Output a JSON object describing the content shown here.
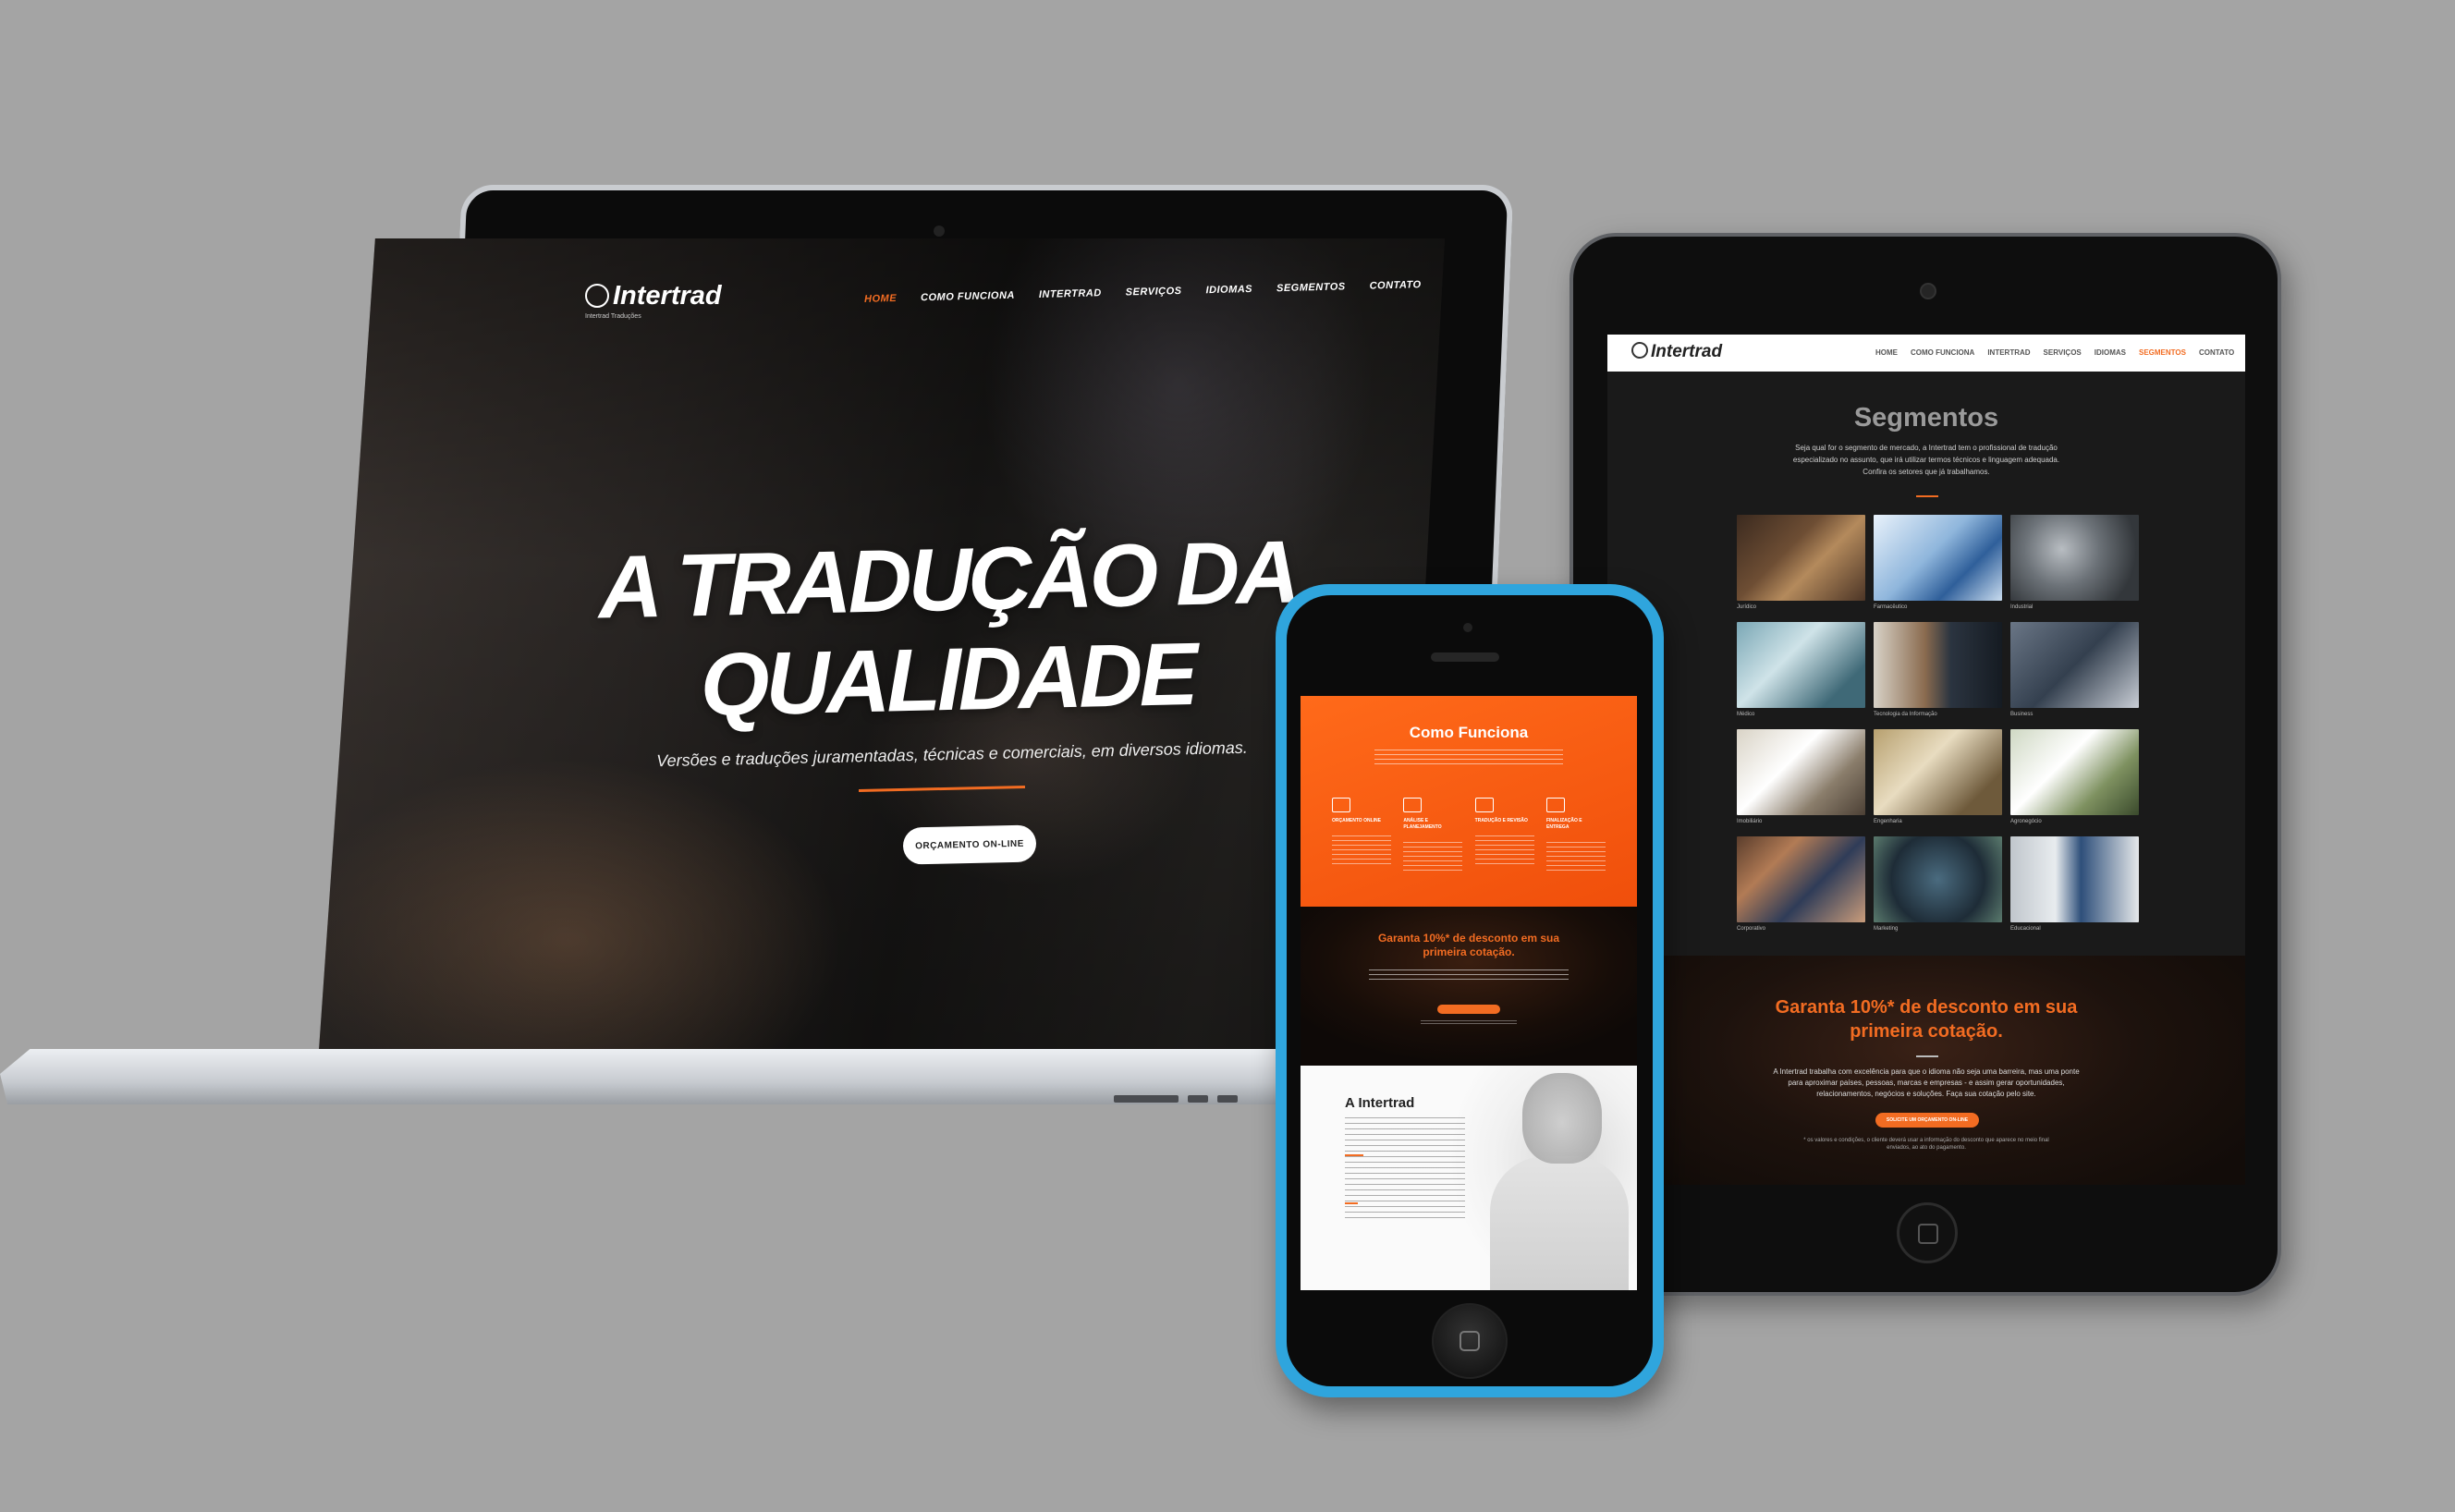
{
  "laptop": {
    "logo": {
      "name": "Intertrad",
      "tagline": "Intertrad Traduções"
    },
    "nav": [
      "HOME",
      "COMO FUNCIONA",
      "INTERTRAD",
      "SERVIÇOS",
      "IDIOMAS",
      "SEGMENTOS",
      "CONTATO"
    ],
    "hero_line1": "A TRADUÇÃO DA",
    "hero_line2": "QUALIDADE",
    "subtitle": "Versões e traduções juramentadas, técnicas e comerciais, em diversos idiomas.",
    "cta": "ORÇAMENTO ON-LINE"
  },
  "tablet": {
    "logo": "Intertrad",
    "nav": [
      "HOME",
      "COMO FUNCIONA",
      "INTERTRAD",
      "SERVIÇOS",
      "IDIOMAS",
      "SEGMENTOS",
      "CONTATO"
    ],
    "active_nav": "SEGMENTOS",
    "title": "Segmentos",
    "intro": "Seja qual for o segmento de mercado, a Intertrad tem o profissional de tradução especializado no assunto, que irá utilizar termos técnicos e linguagem adequada. Confira os setores que já trabalhamos.",
    "segments": [
      "Jurídico",
      "Farmacêutico",
      "Industrial",
      "Médico",
      "Tecnologia da Informação",
      "Business",
      "Imobiliário",
      "Engenharia",
      "Agronegócio",
      "Corporativo",
      "Marketing",
      "Educacional"
    ],
    "cta_line1": "Garanta 10%* de desconto em sua",
    "cta_line2": "primeira cotação.",
    "cta_text": "A Intertrad trabalha com excelência para que o idioma não seja uma barreira, mas uma ponte para aproximar países, pessoas, marcas e empresas - e assim gerar oportunidades, relacionamentos, negócios e soluções. Faça sua cotação pelo site.",
    "cta_button": "SOLICITE UM ORÇAMENTO ON-LINE",
    "cta_note": "* os valores e condições, o cliente deverá usar a informação do desconto que aparece no meio final enviados, ao ato do pagamento."
  },
  "phone": {
    "section1_title": "Como Funciona",
    "steps": [
      "ORÇAMENTO ONLINE",
      "ANÁLISE E PLANEJAMENTO",
      "TRADUÇÃO E REVISÃO",
      "FINALIZAÇÃO E ENTREGA"
    ],
    "cta_line1": "Garanta 10%* de desconto em sua",
    "cta_line2": "primeira cotação.",
    "section3_title": "A Intertrad"
  },
  "colors": {
    "accent": "#f26c22",
    "phone_case": "#2fa5dd",
    "background": "#a4a4a4"
  }
}
